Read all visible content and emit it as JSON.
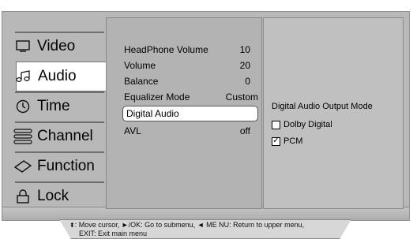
{
  "categories": [
    {
      "label": "Video",
      "icon": "monitor-icon"
    },
    {
      "label": "Audio",
      "icon": "music-note-icon"
    },
    {
      "label": "Time",
      "icon": "clock-icon"
    },
    {
      "label": "Channel",
      "icon": "channel-icon"
    },
    {
      "label": "Function",
      "icon": "function-icon"
    },
    {
      "label": "Lock",
      "icon": "lock-icon"
    }
  ],
  "selected_category": "Audio",
  "audio_menu": [
    {
      "label": "HeadPhone Volume",
      "value": "10"
    },
    {
      "label": "Volume",
      "value": "20"
    },
    {
      "label": "Balance",
      "value": "0"
    },
    {
      "label": "Equalizer Mode",
      "value": "Custom"
    },
    {
      "label": "Digital Audio",
      "value": ""
    },
    {
      "label": "AVL",
      "value": "off"
    }
  ],
  "highlighted_item": "Digital Audio",
  "detail": {
    "title": "Digital Audio Output Mode",
    "options": [
      {
        "label": "Dolby Digital",
        "checked": false
      },
      {
        "label": "PCM",
        "checked": true
      }
    ]
  },
  "help": {
    "line1": ": Move cursor,  ►/OK: Go to submenu,  ◄ ME NU: Return to upper menu,",
    "line2": "EXIT: Exit main menu"
  }
}
